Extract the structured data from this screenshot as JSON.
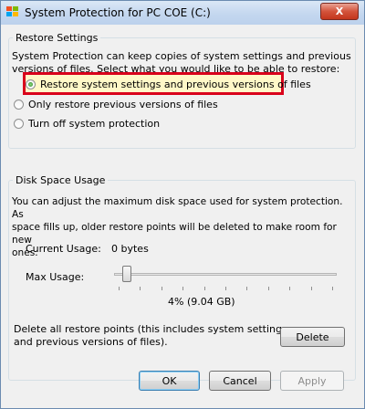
{
  "window": {
    "title": "System Protection for PC COE (C:)",
    "close_label": "X"
  },
  "restore_settings": {
    "legend": "Restore Settings",
    "description_line1": "System Protection can keep copies of system settings and previous",
    "description_line2": "versions of files. Select what you would like to be able to restore:",
    "options": [
      {
        "label": "Restore system settings and previous versions of files",
        "checked": true
      },
      {
        "label": "Only restore previous versions of files",
        "checked": false
      },
      {
        "label": "Turn off system protection",
        "checked": false
      }
    ]
  },
  "disk_space": {
    "legend": "Disk Space Usage",
    "description_line1": "You can adjust the maximum disk space used for system protection. As",
    "description_line2": "space fills up, older restore points will be deleted to make room for new",
    "description_line3": "ones.",
    "current_usage_label": "Current Usage:",
    "current_usage_value": "0 bytes",
    "max_usage_label": "Max Usage:",
    "max_usage_fraction": 0.04,
    "max_usage_value": "4% (9.04 GB)",
    "delete_text_line1": "Delete all restore points (this includes system settings",
    "delete_text_line2": "and previous versions of files).",
    "delete_label": "Delete"
  },
  "buttons": {
    "ok": "OK",
    "cancel": "Cancel",
    "apply": "Apply"
  },
  "colors": {
    "highlight_border": "#d9001b",
    "close_button": "#c3361d"
  }
}
